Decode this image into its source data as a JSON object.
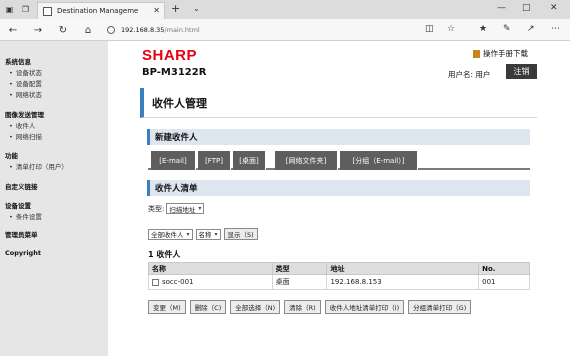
{
  "browser": {
    "tab_title": "Destination Manageme",
    "url_host": "192.168.8.35",
    "url_path": "/main.html"
  },
  "sidebar": {
    "groups": [
      {
        "title": "系统信息",
        "items": [
          "设备状态",
          "设备配置",
          "网络状态"
        ]
      },
      {
        "title": "图像发送管理",
        "items": [
          "收件人",
          "网络扫描"
        ]
      },
      {
        "title": "功能",
        "items": [
          "清单打印（用户）"
        ]
      },
      {
        "title": "自定义链接",
        "items": []
      },
      {
        "title": "设备设置",
        "items": [
          "条件设置"
        ]
      },
      {
        "title": "管理员菜单",
        "items": []
      },
      {
        "title": "Copyright",
        "items": []
      }
    ]
  },
  "header": {
    "logo": "SHARP",
    "model": "BP-M3122R",
    "manual_link": "操作手册下载",
    "username_label": "用户名: 用户",
    "logout": "注销"
  },
  "page_title": "收件人管理",
  "new_recipient": {
    "heading": "新建收件人",
    "tabs": [
      "[E-mail]",
      "[FTP]",
      "[桌面]",
      "[网络文件夹]",
      "[分组（E-mail）]"
    ]
  },
  "recipient_list": {
    "heading": "收件人清单",
    "type_label": "类型:",
    "type_value": "扫描地址",
    "filter_value": "全部收件人",
    "sort_value": "名称",
    "show_button": "显示（S)",
    "count_text": "1 收件人",
    "columns": [
      "名称",
      "类型",
      "地址",
      "No."
    ],
    "rows": [
      {
        "name": "socc-001",
        "type": "桌面",
        "address": "192.168.8.153",
        "no": "001"
      }
    ]
  },
  "actions": [
    "变更（M)",
    "删除（C)",
    "全部选择（N)",
    "清除（R)",
    "收件人地址清单打印（I)",
    "分组清单打印（G)"
  ],
  "colors": {
    "brand": "#e60012",
    "accent": "#3c7fbf",
    "tab_bg": "#5e5e5e"
  }
}
